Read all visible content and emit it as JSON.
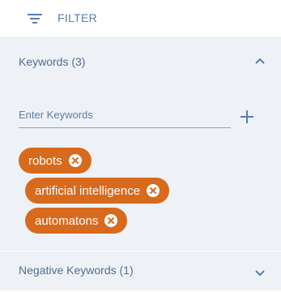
{
  "header": {
    "filter_label": "FILTER",
    "icon": "filter-icon"
  },
  "keywords": {
    "title": "Keywords (3)",
    "expanded": true,
    "input_placeholder": "Enter Keywords",
    "input_value": "",
    "chips": [
      "robots",
      "artificial intelligence",
      "automatons"
    ]
  },
  "negative_keywords": {
    "title": "Negative Keywords (1)",
    "expanded": false
  },
  "colors": {
    "accent": "#5b7ea8",
    "chip": "#d86a1e",
    "panel": "#eef2f7"
  }
}
